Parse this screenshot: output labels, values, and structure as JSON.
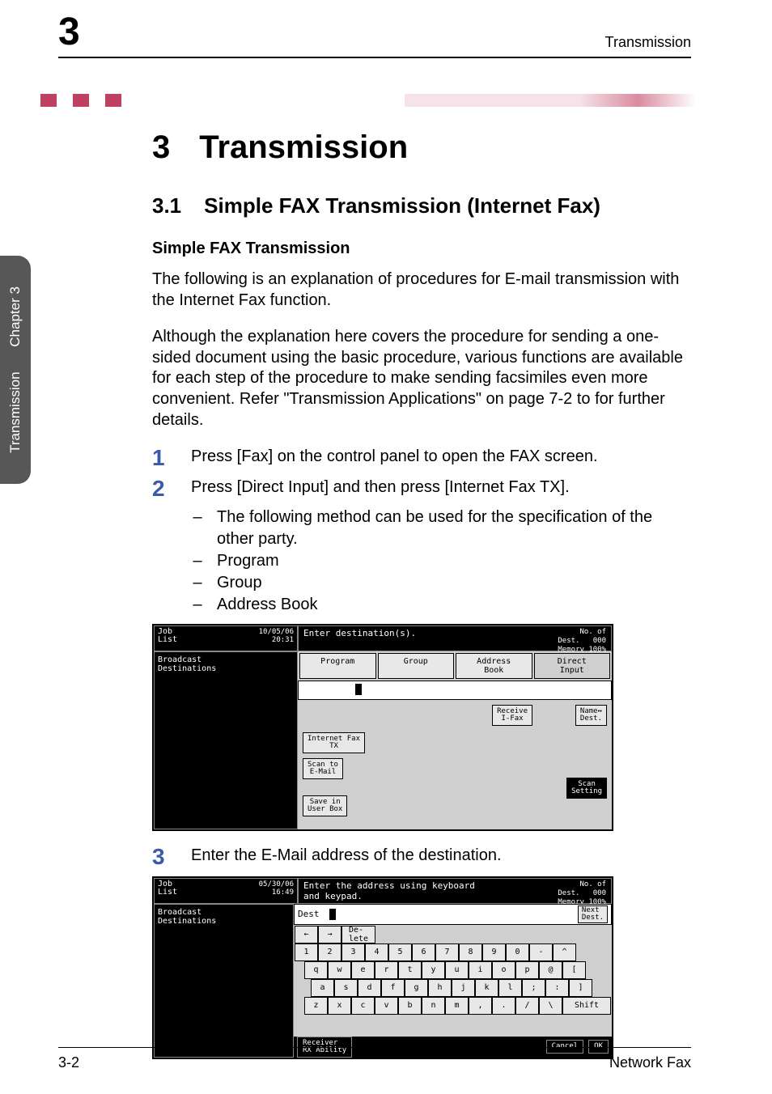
{
  "header": {
    "chapter_num": "3",
    "running_title": "Transmission"
  },
  "sidetab": {
    "primary": "Transmission",
    "secondary": "Chapter 3"
  },
  "title": {
    "num": "3",
    "text": "Transmission"
  },
  "section": {
    "num": "3.1",
    "text": "Simple FAX Transmission (Internet Fax)"
  },
  "sub_heading": "Simple FAX Transmission",
  "paragraphs": {
    "p1": "The following is an explanation of procedures for E-mail transmission with the Internet Fax function.",
    "p2": "Although the explanation here covers the procedure for sending a one-sided document using the basic procedure, various functions are available for each step of the procedure to make sending facsimiles even more convenient. Refer \"Transmission Applications\" on page 7-2 to for further details."
  },
  "steps": {
    "s1": {
      "num": "1",
      "text": "Press [Fax] on the control panel to open the FAX screen."
    },
    "s2": {
      "num": "2",
      "text": "Press [Direct Input] and then press [Internet Fax TX].",
      "sub1": "The following method can be used for the specification of the other party.",
      "sub2": "Program",
      "sub3": "Group",
      "sub4": "Address Book"
    },
    "s3": {
      "num": "3",
      "text": "Enter the E-Mail address of the destination."
    }
  },
  "shot1": {
    "job_label": "Job\nList",
    "timestamp": "10/05/06\n20:31",
    "banner": "Enter destination(s).",
    "dest_count_label": "No. of\nDest.",
    "dest_count": "000",
    "memory": "Memory 100%",
    "left_title": "Broadcast\nDestinations",
    "tabs": {
      "program": "Program",
      "group": "Group",
      "addr": "Address\nBook",
      "direct": "Direct\nInput"
    },
    "btn_receive": "Receive\nI-Fax",
    "btn_namedest": "Name↔\nDest.",
    "btn_ifax": "Internet Fax\nTX",
    "btn_scan": "Scan to\nE-Mail",
    "btn_save": "Save in\nUser Box",
    "btn_scansetting": "Scan\nSetting"
  },
  "shot2": {
    "job_label": "Job\nList",
    "timestamp": "05/30/06\n16:49",
    "banner": "Enter the address using keyboard\nand keypad.",
    "dest_count_label": "No. of\nDest.",
    "dest_count": "000",
    "memory": "Memory 100%",
    "left_title": "Broadcast\nDestinations",
    "dest_label": "Dest",
    "next_dest": "Next\nDest.",
    "nav_back": "←",
    "nav_fwd": "→",
    "nav_del": "De-\nlete",
    "row_num": [
      "1",
      "2",
      "3",
      "4",
      "5",
      "6",
      "7",
      "8",
      "9",
      "0",
      "-",
      "^"
    ],
    "row_q": [
      "q",
      "w",
      "e",
      "r",
      "t",
      "y",
      "u",
      "i",
      "o",
      "p",
      "@",
      "["
    ],
    "row_a": [
      "a",
      "s",
      "d",
      "f",
      "g",
      "h",
      "j",
      "k",
      "l",
      ";",
      ":",
      "]"
    ],
    "row_z": [
      "z",
      "x",
      "c",
      "v",
      "b",
      "n",
      "m",
      ",",
      ".",
      "/",
      "\\",
      "Shift"
    ],
    "btn_rx": "Receiver\nRX Ability",
    "btn_cancel": "Cancel",
    "btn_ok": "OK"
  },
  "footer": {
    "left": "3-2",
    "right": "Network Fax"
  }
}
